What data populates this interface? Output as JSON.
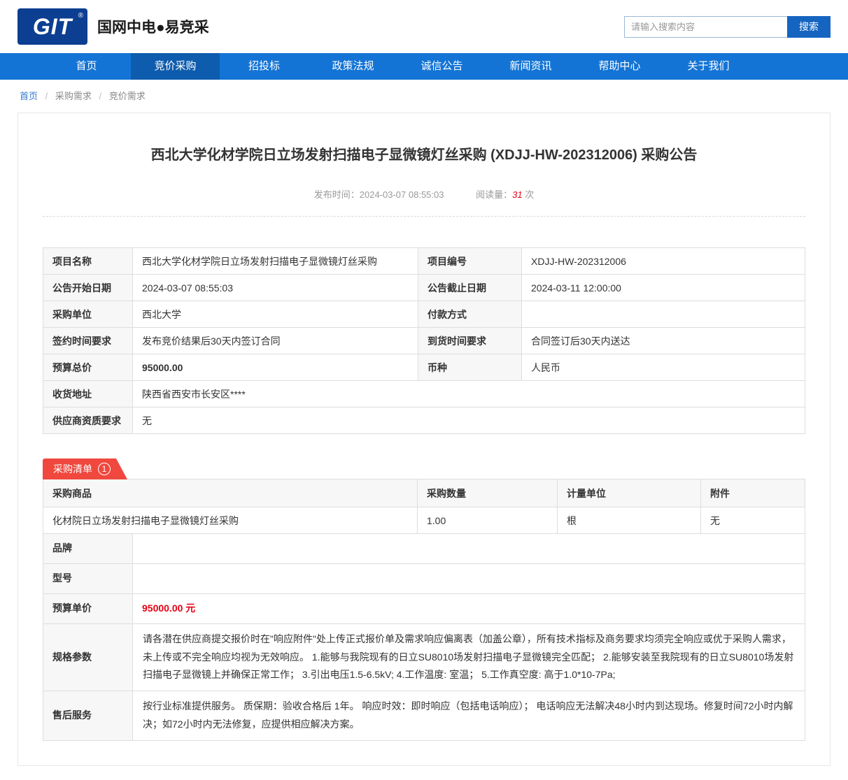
{
  "colors": {
    "nav_blue": "#1374d5",
    "nav_active_blue": "#0d5cae",
    "logo_blue": "#0c3e91",
    "accent_red": "#e60012",
    "badge_red": "#f0483e"
  },
  "header": {
    "logo_text": "GIT",
    "logo_reg": "®",
    "site_title": "国网中电●易竞采",
    "search": {
      "placeholder": "请输入搜索内容",
      "button_label": "搜索"
    }
  },
  "nav": {
    "items": [
      {
        "label": "首页"
      },
      {
        "label": "竞价采购"
      },
      {
        "label": "招投标"
      },
      {
        "label": "政策法规"
      },
      {
        "label": "诚信公告"
      },
      {
        "label": "新闻资讯"
      },
      {
        "label": "帮助中心"
      },
      {
        "label": "关于我们"
      }
    ]
  },
  "breadcrumb": {
    "separator": "/",
    "items": [
      "首页",
      "采购需求",
      "竞价需求"
    ]
  },
  "article": {
    "title": "西北大学化材学院日立场发射扫描电子显微镜灯丝采购 (XDJJ-HW-202312006) 采购公告",
    "publish_label": "发布时间：",
    "publish_time": "2024-03-07 08:55:03",
    "views_label": "阅读量：",
    "views_count": "31",
    "views_unit": "次"
  },
  "info": {
    "rows": [
      {
        "label1": "项目名称",
        "value1": "西北大学化材学院日立场发射扫描电子显微镜灯丝采购",
        "label2": "项目编号",
        "value2": "XDJJ-HW-202312006"
      },
      {
        "label1": "公告开始日期",
        "value1": "2024-03-07 08:55:03",
        "label2": "公告截止日期",
        "value2": "2024-03-11 12:00:00"
      },
      {
        "label1": "采购单位",
        "value1": "西北大学",
        "label2": "付款方式",
        "value2": ""
      },
      {
        "label1": "签约时间要求",
        "value1": "发布竞价结果后30天内签订合同",
        "label2": "到货时间要求",
        "value2": "合同签订后30天内送达"
      },
      {
        "label1": "预算总价",
        "value1": "95000.00",
        "label2": "币种",
        "value2": "人民币"
      }
    ],
    "full_rows": [
      {
        "label": "收货地址",
        "value": "陕西省西安市长安区****"
      },
      {
        "label": "供应商资质要求",
        "value": "无"
      }
    ]
  },
  "list_section": {
    "badge_label": "采购清单",
    "badge_count": "1",
    "headers": [
      "采购商品",
      "采购数量",
      "计量单位",
      "附件"
    ],
    "item_row": [
      "化材院日立场发射扫描电子显微镜灯丝采购",
      "1.00",
      "根",
      "无"
    ],
    "details": [
      {
        "label": "品牌",
        "value": ""
      },
      {
        "label": "型号",
        "value": ""
      },
      {
        "label": "预算单价",
        "value": "95000.00 元"
      },
      {
        "label": "规格参数",
        "value": "请各潜在供应商提交报价时在\"响应附件\"处上传正式报价单及需求响应偏离表（加盖公章），所有技术指标及商务要求均须完全响应或优于采购人需求，未上传或不完全响应均视为无效响应。 1.能够与我院现有的日立SU8010场发射扫描电子显微镜完全匹配； 2.能够安装至我院现有的日立SU8010场发射扫描电子显微镜上并确保正常工作； 3.引出电压1.5-6.5kV; 4.工作温度: 室温； 5.工作真空度: 高于1.0*10-7Pa;"
      },
      {
        "label": "售后服务",
        "value": "按行业标准提供服务。 质保期：验收合格后 1年。 响应时效：即时响应（包括电话响应）； 电话响应无法解决48小时内到达现场。修复时间72小时内解决；如72小时内无法修复，应提供相应解决方案。"
      }
    ]
  }
}
